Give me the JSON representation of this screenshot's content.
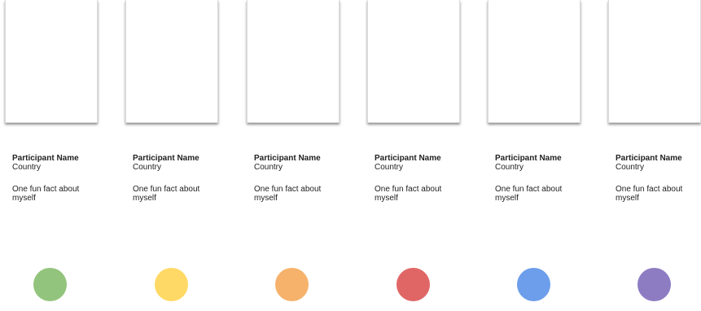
{
  "participants": [
    {
      "name": "Participant Name",
      "country": "Country",
      "fact": "One fun fact about myself",
      "color": "#93c47d"
    },
    {
      "name": "Participant Name",
      "country": "Country",
      "fact": "One fun fact about myself",
      "color": "#ffd966"
    },
    {
      "name": "Participant Name",
      "country": "Country",
      "fact": "One fun fact about myself",
      "color": "#f6b26b"
    },
    {
      "name": "Participant Name",
      "country": "Country",
      "fact": "One fun fact about myself",
      "color": "#e06666"
    },
    {
      "name": "Participant Name",
      "country": "Country",
      "fact": "One fun fact about myself",
      "color": "#6d9eeb"
    },
    {
      "name": "Participant Name",
      "country": "Country",
      "fact": "One fun fact about myself",
      "color": "#8e7cc3"
    }
  ]
}
